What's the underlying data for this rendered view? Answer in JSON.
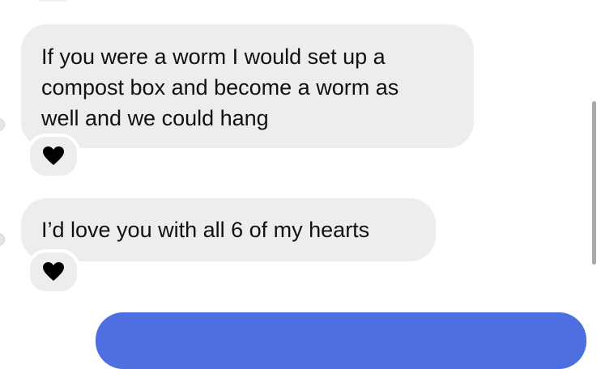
{
  "messages": [
    {
      "direction": "incoming",
      "lines": [
        "If you were a worm I would set up a",
        "compost box and become a worm as",
        "well and we could hang"
      ],
      "reaction": "black-heart-icon"
    },
    {
      "direction": "incoming",
      "lines": [
        "I’d love you with all 6 of my hearts"
      ],
      "reaction": "black-heart-icon"
    }
  ],
  "colors": {
    "incoming_bubble": "#ededef",
    "outgoing_bubble": "#4d6fe0",
    "text": "#111111",
    "reaction_heart": "#000000"
  }
}
